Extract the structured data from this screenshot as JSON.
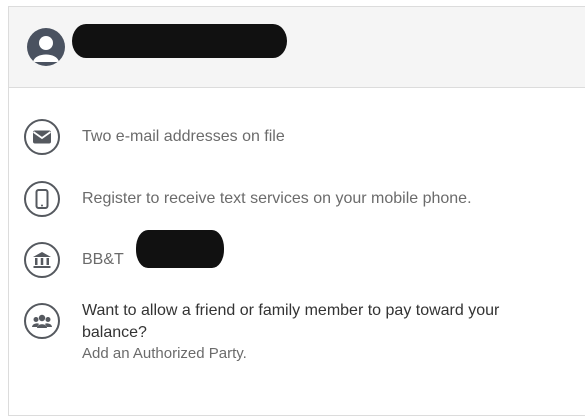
{
  "header": {
    "avatar_icon": "user-icon"
  },
  "rows": [
    {
      "icon": "envelope-icon",
      "text": "Two e-mail addresses on file"
    },
    {
      "icon": "mobile-phone-icon",
      "text": "Register to receive text services on your mobile phone."
    },
    {
      "icon": "bank-icon",
      "text": "BB&T"
    },
    {
      "icon": "group-icon",
      "text": "Want to allow a friend or family member to pay toward your balance?",
      "link": "Add an Authorized Party."
    }
  ],
  "colors": {
    "header_bg": "#f5f5f5",
    "icon": "#55595f",
    "text": "#6b6b6b",
    "dark_text": "#333333"
  }
}
